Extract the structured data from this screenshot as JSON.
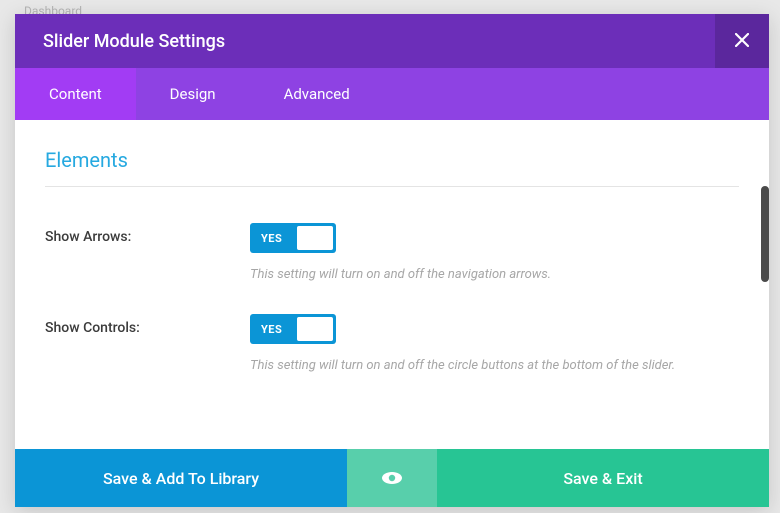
{
  "background": {
    "dashboard_label": "Dashboard"
  },
  "modal": {
    "title": "Slider Module Settings"
  },
  "tabs": {
    "content": "Content",
    "design": "Design",
    "advanced": "Advanced"
  },
  "section": {
    "title": "Elements"
  },
  "settings": {
    "show_arrows": {
      "label": "Show Arrows:",
      "toggle_text": "YES",
      "description": "This setting will turn on and off the navigation arrows."
    },
    "show_controls": {
      "label": "Show Controls:",
      "toggle_text": "YES",
      "description": "This setting will turn on and off the circle buttons at the bottom of the slider."
    }
  },
  "footer": {
    "save_library": "Save & Add To Library",
    "save_exit": "Save & Exit"
  }
}
